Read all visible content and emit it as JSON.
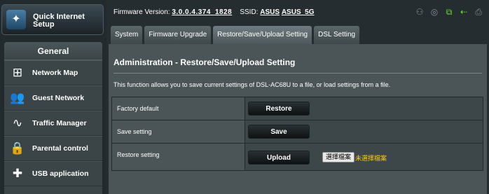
{
  "sidebar": {
    "quick_setup": "Quick Internet Setup",
    "general_header": "General",
    "items": [
      {
        "label": "Network Map",
        "icon": "network-map-icon"
      },
      {
        "label": "Guest Network",
        "icon": "guest-network-icon"
      },
      {
        "label": "Traffic Manager",
        "icon": "traffic-manager-icon"
      },
      {
        "label": "Parental control",
        "icon": "parental-control-icon"
      },
      {
        "label": "USB application",
        "icon": "usb-application-icon"
      }
    ]
  },
  "topbar": {
    "firmware_label": "Firmware Version:",
    "firmware_version": "3.0.0.4.374_1828",
    "ssid_label": "SSID:",
    "ssid_1": "ASUS",
    "ssid_2": "ASUS_5G",
    "status_icons": [
      "users-icon",
      "globe-icon",
      "lan-icon",
      "usb-icon",
      "printer-icon"
    ]
  },
  "tabs": [
    {
      "label": "System",
      "active": false
    },
    {
      "label": "Firmware Upgrade",
      "active": false
    },
    {
      "label": "Restore/Save/Upload Setting",
      "active": true
    },
    {
      "label": "DSL Setting",
      "active": false
    }
  ],
  "main": {
    "title": "Administration - Restore/Save/Upload Setting",
    "description": "This function allows you to save current settings of DSL-AC68U to a file, or load settings from a file.",
    "rows": [
      {
        "label": "Factory default",
        "button": "Restore"
      },
      {
        "label": "Save setting",
        "button": "Save"
      },
      {
        "label": "Restore setting",
        "button": "Upload",
        "file_button": "選擇檔案",
        "file_status": "未選擇檔案"
      }
    ]
  },
  "colors": {
    "background": "#262d30",
    "panel": "#4b5558",
    "file_status": "#ffcc00"
  }
}
